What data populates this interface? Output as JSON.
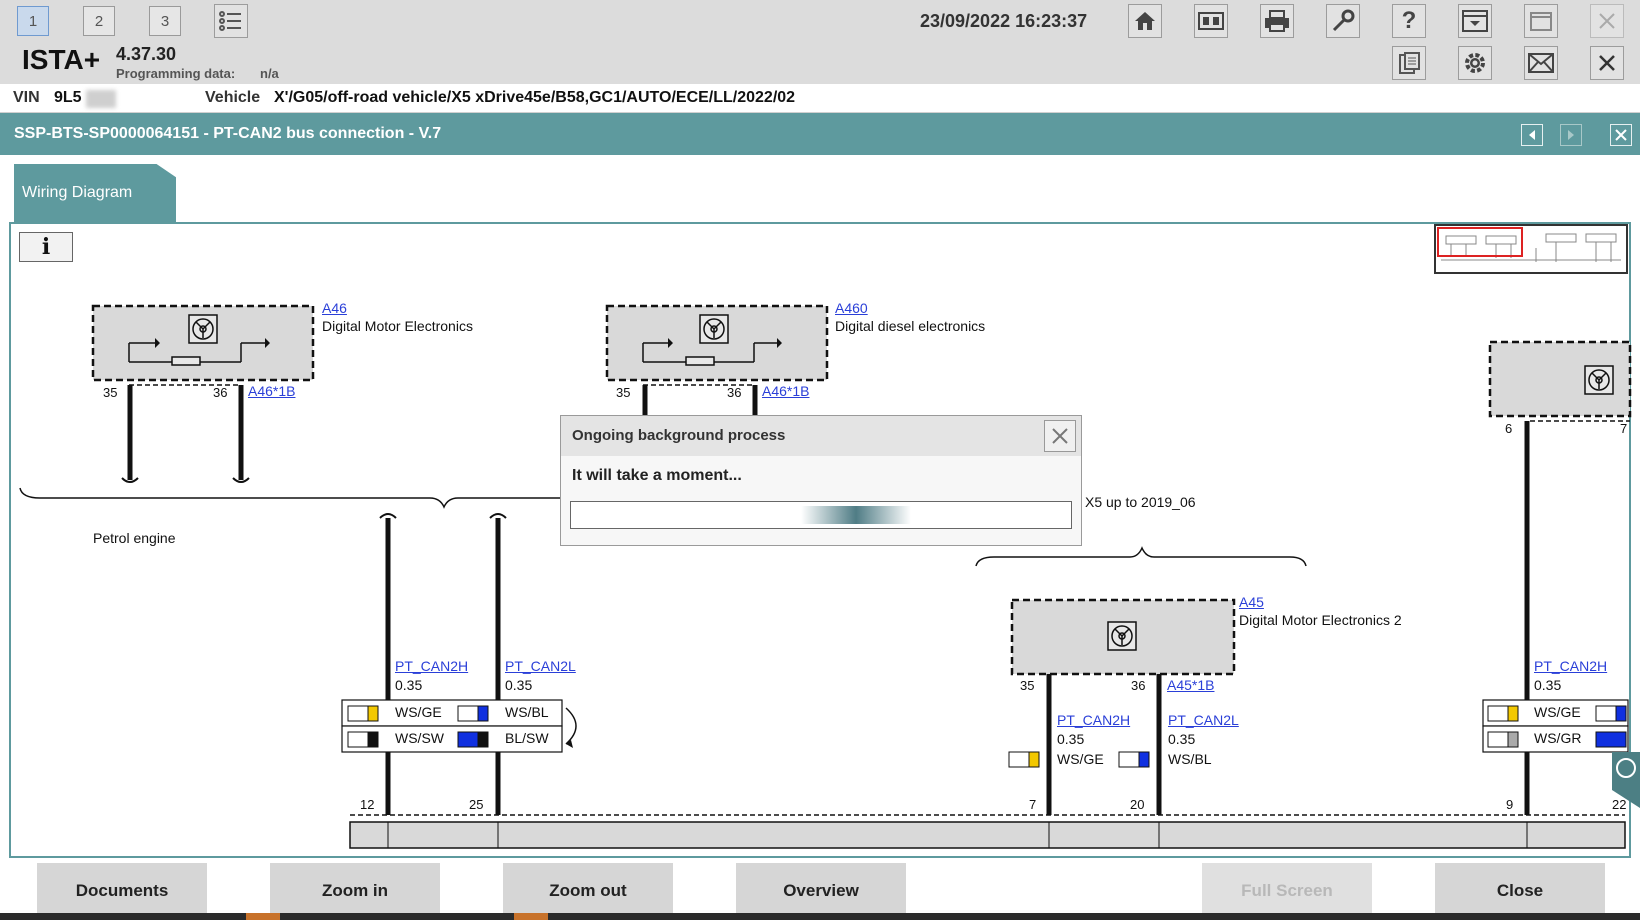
{
  "topbar": {
    "tabs": [
      "1",
      "2",
      "3"
    ],
    "datetime": "23/09/2022 16:23:37",
    "icons": [
      "list-icon",
      "home-icon",
      "book-icon",
      "printer-icon",
      "wrench-icon",
      "help-icon",
      "dropdown-icon",
      "window-icon",
      "close-icon"
    ]
  },
  "header": {
    "logo": "ISTA+",
    "version": "4.37.30",
    "programming_label": "Programming data:",
    "programming_value": "n/a"
  },
  "vehicle_row": {
    "vin_label": "VIN",
    "vin_value": "9L5",
    "vehicle_label": "Vehicle",
    "vehicle_value": "X'/G05/off-road vehicle/X5 xDrive45e/B58,GC1/AUTO/ECE/LL/2022/02"
  },
  "document": {
    "title": "SSP-BTS-SP0000064151 - PT-CAN2 bus connection - V.7",
    "tab_label": "Wiring Diagram"
  },
  "diagram": {
    "a46_id": "A46",
    "a46_name": "Digital Motor Electronics",
    "a46_conn": "A46*1B",
    "a460_id": "A460",
    "a460_name": "Digital diesel electronics",
    "a460_conn": "A46*1B",
    "a45_id": "A45",
    "a45_name": "Digital Motor Electronics 2",
    "a45_conn": "A45*1B",
    "petrol_label": "Petrol engine",
    "x5_label": "X5 up to 2019_06",
    "pins": {
      "p35a": "35",
      "p36a": "36",
      "p35b": "35",
      "p36b": "36",
      "p6": "6",
      "p7": "7",
      "p35c": "35",
      "p36c": "36",
      "p12": "12",
      "p25": "25",
      "p7b": "7",
      "p20": "20",
      "p9": "9",
      "p22": "22"
    },
    "wires": {
      "can_h": "PT_CAN2H",
      "can_l": "PT_CAN2L",
      "size": "0.35",
      "ws_ge": "WS/GE",
      "ws_bl": "WS/BL",
      "ws_sw": "WS/SW",
      "bl_sw": "BL/SW",
      "ws_gr": "WS/GR"
    }
  },
  "dialog": {
    "title": "Ongoing background process",
    "message": "It will take a moment...",
    "progress": "indeterminate"
  },
  "buttons": {
    "documents": "Documents",
    "zoom_in": "Zoom in",
    "zoom_out": "Zoom out",
    "overview": "Overview",
    "full_screen": "Full Screen",
    "close": "Close"
  },
  "colors": {
    "accent": "#5e9a9e",
    "link": "#2a3fd8",
    "wire_yellow": "#f2c800",
    "wire_blue": "#1030e0"
  }
}
